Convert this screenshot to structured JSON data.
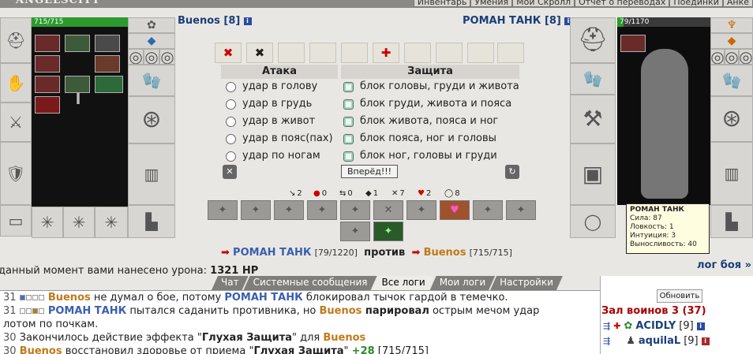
{
  "app": {
    "logo": "ANGELSCITY"
  },
  "top_menu": [
    "Инвентарь",
    "Умения",
    "Мои Скролл",
    "Отчет о переводах",
    "Поединки",
    "Анке"
  ],
  "player_left": {
    "name": "Buenos [8]",
    "hp": "715/715"
  },
  "player_right": {
    "name": "РОМАН ТАНК [8]",
    "hp": "79/1170"
  },
  "combat": {
    "attack_header": "Атака",
    "defense_header": "Защита",
    "attacks": [
      "удар в голову",
      "удар в грудь",
      "удар в живот",
      "удар в пояс(пах)",
      "удар по ногам"
    ],
    "defenses": [
      "блок головы, груди и живота",
      "блок груди, живота и пояса",
      "блок живота, пояса и ног",
      "блок пояса, ног и головы",
      "блок ног, головы и груди"
    ],
    "go_button": "Вперёд!!!"
  },
  "stats": [
    {
      "icon": "sword-icon",
      "value": "2"
    },
    {
      "icon": "drop-icon",
      "value": "0"
    },
    {
      "icon": "counter-icon",
      "value": "0"
    },
    {
      "icon": "block-icon",
      "value": "1"
    },
    {
      "icon": "cross-icon",
      "value": "7"
    },
    {
      "icon": "heart-icon",
      "value": "2"
    },
    {
      "icon": "shield-icon",
      "value": "8"
    }
  ],
  "versus": {
    "left_name": "РОМАН ТАНК",
    "left_hp": "[79/1220]",
    "word": "против",
    "right_name": "Buenos",
    "right_hp": "[715/715]"
  },
  "damage_line": "данный момент вами нанесено урона:",
  "damage_value": "1321 HP",
  "battle_log_link": "лог боя »",
  "tooltip": {
    "name": "РОМАН ТАНК",
    "lines": [
      "Сила: 87",
      "Ловкость: 1",
      "Интуиция: 3",
      "Выносливость: 40"
    ]
  },
  "tabs": [
    "Чат",
    "Системные сообщения",
    "Все логи",
    "Мои логи",
    "Настройки"
  ],
  "log": [
    {
      "time": "31",
      "a": "Buenos",
      "t1": " не думал о бое, потому ",
      "b": "РОМАН ТАНК",
      "t2": " блокировал тычок гардой в темечко."
    },
    {
      "time": "31",
      "a": "РОМАН ТАНК",
      "t1": " пытался саданить противника, но ",
      "b": "Buenos",
      "bold": " парировал",
      "t2": " острым мечом удар"
    },
    {
      "cont": "лотом по почкам."
    },
    {
      "time": "30",
      "t1": " Закончилось действие эффекта \"",
      "bold": "Глухая Защита",
      "t2": "\" для ",
      "b": "Buenos"
    },
    {
      "time": "30",
      "a": "Buenos",
      "t1": " восстановил здоровье от приема \"",
      "bold": "Глухая Защита",
      "t2": "\" ",
      "plus": "+28",
      "hp": " [715/715]"
    }
  ],
  "right_panel": {
    "refresh": "Обновить",
    "hall": "Зал воинов 3 (37)",
    "players": [
      {
        "name": "ACIDLY",
        "lvl": "[9]"
      },
      {
        "name": "aquilaL",
        "lvl": "[9]"
      }
    ]
  },
  "colors": {
    "name_blue": "#1a3f7a",
    "orange": "#c07a1a",
    "green": "#2b8a2b",
    "hall_red": "#a00000"
  }
}
